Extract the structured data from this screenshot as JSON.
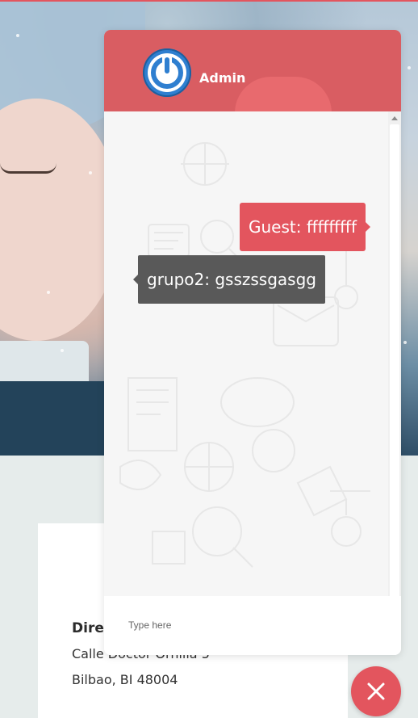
{
  "chat": {
    "admin_name": "Admin",
    "messages": [
      {
        "text": "Guest: fffffffff",
        "from": "guest"
      },
      {
        "text": "grupo2: gsszssgasgg",
        "from": "group"
      }
    ],
    "input_placeholder": "Type here"
  },
  "address": {
    "title": "Direc",
    "line1": "Calle Doctor Ornilla 5",
    "line2": "Bilbao, BI 48004"
  },
  "colors": {
    "accent": "#e3555e",
    "header": "#d95d62",
    "group_bubble": "#595959"
  },
  "icons": {
    "avatar": "power-icon",
    "close": "close-icon"
  }
}
